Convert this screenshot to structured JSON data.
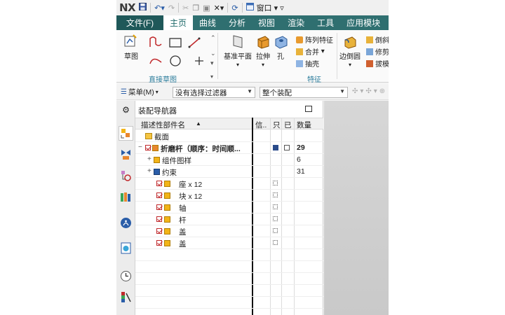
{
  "app": {
    "logo": "NX",
    "window_menu": "窗口"
  },
  "tabs": {
    "file": "文件(F)",
    "items": [
      "主页",
      "曲线",
      "分析",
      "视图",
      "渲染",
      "工具",
      "应用模块"
    ],
    "active_index": 0
  },
  "ribbon": {
    "sketch": "草图",
    "sketch_group_label": "直接草图",
    "datum_plane": "基准平面",
    "extrude": "拉伸",
    "hole": "孔",
    "pattern_feature": "阵列特征",
    "unite": "合并",
    "shell": "抽壳",
    "edge_blend": "边倒圆",
    "chamfer": "倒斜",
    "trim": "修剪",
    "draft": "拔模",
    "feature_group_label": "特征"
  },
  "selection_bar": {
    "menu": "菜单(M)",
    "filter": "没有选择过滤器",
    "scope": "整个装配"
  },
  "navigator": {
    "title": "装配导航器",
    "columns": {
      "name": "描述性部件名",
      "info": "信..",
      "col_r": "只",
      "col_m": "已",
      "qty": "数量"
    },
    "rows": [
      {
        "label": "截面",
        "qty": ""
      },
      {
        "label": "折磨杆（顺序：时间顺...",
        "qty": "29"
      },
      {
        "label": "组件图样",
        "qty": "6"
      },
      {
        "label": "约束",
        "qty": "31"
      },
      {
        "label": "座 x 12",
        "qty": ""
      },
      {
        "label": "块 x 12",
        "qty": ""
      },
      {
        "label": "轴",
        "qty": ""
      },
      {
        "label": "杆",
        "qty": ""
      },
      {
        "label": "盖",
        "qty": ""
      },
      {
        "label": "盖",
        "qty": ""
      }
    ]
  },
  "colors": {
    "ribbon_tab_bg": "#2f6f70",
    "file_tab_bg": "#1f5859",
    "group_label": "#2b7c9b",
    "checkbox": "#c0282b"
  }
}
